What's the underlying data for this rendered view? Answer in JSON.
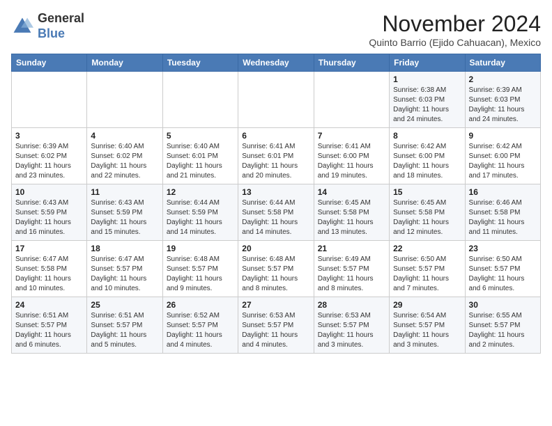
{
  "header": {
    "logo_line1": "General",
    "logo_line2": "Blue",
    "month_title": "November 2024",
    "location": "Quinto Barrio (Ejido Cahuacan), Mexico"
  },
  "days_of_week": [
    "Sunday",
    "Monday",
    "Tuesday",
    "Wednesday",
    "Thursday",
    "Friday",
    "Saturday"
  ],
  "weeks": [
    [
      {
        "day": "",
        "info": ""
      },
      {
        "day": "",
        "info": ""
      },
      {
        "day": "",
        "info": ""
      },
      {
        "day": "",
        "info": ""
      },
      {
        "day": "",
        "info": ""
      },
      {
        "day": "1",
        "info": "Sunrise: 6:38 AM\nSunset: 6:03 PM\nDaylight: 11 hours and 24 minutes."
      },
      {
        "day": "2",
        "info": "Sunrise: 6:39 AM\nSunset: 6:03 PM\nDaylight: 11 hours and 24 minutes."
      }
    ],
    [
      {
        "day": "3",
        "info": "Sunrise: 6:39 AM\nSunset: 6:02 PM\nDaylight: 11 hours and 23 minutes."
      },
      {
        "day": "4",
        "info": "Sunrise: 6:40 AM\nSunset: 6:02 PM\nDaylight: 11 hours and 22 minutes."
      },
      {
        "day": "5",
        "info": "Sunrise: 6:40 AM\nSunset: 6:01 PM\nDaylight: 11 hours and 21 minutes."
      },
      {
        "day": "6",
        "info": "Sunrise: 6:41 AM\nSunset: 6:01 PM\nDaylight: 11 hours and 20 minutes."
      },
      {
        "day": "7",
        "info": "Sunrise: 6:41 AM\nSunset: 6:00 PM\nDaylight: 11 hours and 19 minutes."
      },
      {
        "day": "8",
        "info": "Sunrise: 6:42 AM\nSunset: 6:00 PM\nDaylight: 11 hours and 18 minutes."
      },
      {
        "day": "9",
        "info": "Sunrise: 6:42 AM\nSunset: 6:00 PM\nDaylight: 11 hours and 17 minutes."
      }
    ],
    [
      {
        "day": "10",
        "info": "Sunrise: 6:43 AM\nSunset: 5:59 PM\nDaylight: 11 hours and 16 minutes."
      },
      {
        "day": "11",
        "info": "Sunrise: 6:43 AM\nSunset: 5:59 PM\nDaylight: 11 hours and 15 minutes."
      },
      {
        "day": "12",
        "info": "Sunrise: 6:44 AM\nSunset: 5:59 PM\nDaylight: 11 hours and 14 minutes."
      },
      {
        "day": "13",
        "info": "Sunrise: 6:44 AM\nSunset: 5:58 PM\nDaylight: 11 hours and 14 minutes."
      },
      {
        "day": "14",
        "info": "Sunrise: 6:45 AM\nSunset: 5:58 PM\nDaylight: 11 hours and 13 minutes."
      },
      {
        "day": "15",
        "info": "Sunrise: 6:45 AM\nSunset: 5:58 PM\nDaylight: 11 hours and 12 minutes."
      },
      {
        "day": "16",
        "info": "Sunrise: 6:46 AM\nSunset: 5:58 PM\nDaylight: 11 hours and 11 minutes."
      }
    ],
    [
      {
        "day": "17",
        "info": "Sunrise: 6:47 AM\nSunset: 5:58 PM\nDaylight: 11 hours and 10 minutes."
      },
      {
        "day": "18",
        "info": "Sunrise: 6:47 AM\nSunset: 5:57 PM\nDaylight: 11 hours and 10 minutes."
      },
      {
        "day": "19",
        "info": "Sunrise: 6:48 AM\nSunset: 5:57 PM\nDaylight: 11 hours and 9 minutes."
      },
      {
        "day": "20",
        "info": "Sunrise: 6:48 AM\nSunset: 5:57 PM\nDaylight: 11 hours and 8 minutes."
      },
      {
        "day": "21",
        "info": "Sunrise: 6:49 AM\nSunset: 5:57 PM\nDaylight: 11 hours and 8 minutes."
      },
      {
        "day": "22",
        "info": "Sunrise: 6:50 AM\nSunset: 5:57 PM\nDaylight: 11 hours and 7 minutes."
      },
      {
        "day": "23",
        "info": "Sunrise: 6:50 AM\nSunset: 5:57 PM\nDaylight: 11 hours and 6 minutes."
      }
    ],
    [
      {
        "day": "24",
        "info": "Sunrise: 6:51 AM\nSunset: 5:57 PM\nDaylight: 11 hours and 6 minutes."
      },
      {
        "day": "25",
        "info": "Sunrise: 6:51 AM\nSunset: 5:57 PM\nDaylight: 11 hours and 5 minutes."
      },
      {
        "day": "26",
        "info": "Sunrise: 6:52 AM\nSunset: 5:57 PM\nDaylight: 11 hours and 4 minutes."
      },
      {
        "day": "27",
        "info": "Sunrise: 6:53 AM\nSunset: 5:57 PM\nDaylight: 11 hours and 4 minutes."
      },
      {
        "day": "28",
        "info": "Sunrise: 6:53 AM\nSunset: 5:57 PM\nDaylight: 11 hours and 3 minutes."
      },
      {
        "day": "29",
        "info": "Sunrise: 6:54 AM\nSunset: 5:57 PM\nDaylight: 11 hours and 3 minutes."
      },
      {
        "day": "30",
        "info": "Sunrise: 6:55 AM\nSunset: 5:57 PM\nDaylight: 11 hours and 2 minutes."
      }
    ]
  ]
}
